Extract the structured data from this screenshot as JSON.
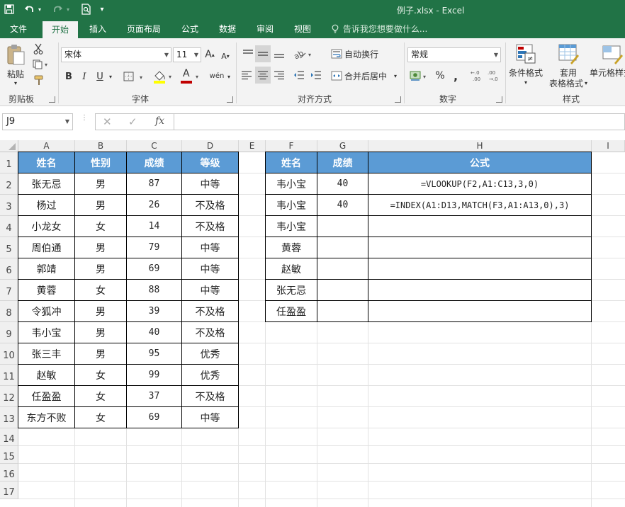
{
  "window": {
    "title": "例子.xlsx - Excel"
  },
  "colors": {
    "excel_green": "#217346",
    "header_blue": "#5b9bd5",
    "ribbon_bg": "#f3f3f3"
  },
  "quick_access": {
    "icons": [
      "save-icon",
      "undo-icon",
      "undo-dropdown-icon",
      "redo-icon",
      "redo-dropdown-icon",
      "print-preview-icon",
      "customize-qat-icon"
    ]
  },
  "tabs": [
    {
      "label": "文件"
    },
    {
      "label": "开始"
    },
    {
      "label": "插入"
    },
    {
      "label": "页面布局"
    },
    {
      "label": "公式"
    },
    {
      "label": "数据"
    },
    {
      "label": "审阅"
    },
    {
      "label": "视图"
    }
  ],
  "tell_me": "告诉我您想要做什么...",
  "ribbon": {
    "clipboard": {
      "label": "剪贴板",
      "paste": "粘贴"
    },
    "font": {
      "label": "字体",
      "name": "宋体",
      "size": "11",
      "bold": "B",
      "italic": "I",
      "underline": "U",
      "grow": "A",
      "shrink": "A",
      "color_letter": "A",
      "phonetic": "wén"
    },
    "alignment": {
      "label": "对齐方式",
      "wrap": "自动换行",
      "merge": "合并后居中"
    },
    "number": {
      "label": "数字",
      "format": "常规",
      "percent": "%",
      "comma": ",",
      "dec_inc": "←.0 .00",
      "dec_dec": ".00 →.0"
    },
    "styles": {
      "label": "样式",
      "cond_format": "条件格式",
      "table_format_1": "套用",
      "table_format_2": "表格格式",
      "cell_style": "单元格样式"
    }
  },
  "formula_bar": {
    "name_box": "J9",
    "cancel": "✕",
    "enter": "✓",
    "fx": "fx",
    "content": ""
  },
  "columns": [
    "A",
    "B",
    "C",
    "D",
    "E",
    "F",
    "G",
    "H",
    "I"
  ],
  "rows": [
    "1",
    "2",
    "3",
    "4",
    "5",
    "6",
    "7",
    "8",
    "9",
    "10",
    "11",
    "12",
    "13",
    "14",
    "15",
    "16",
    "17"
  ],
  "table1": {
    "headers": [
      "姓名",
      "性别",
      "成绩",
      "等级"
    ],
    "rows": [
      [
        "张无忌",
        "男",
        "87",
        "中等"
      ],
      [
        "杨过",
        "男",
        "26",
        "不及格"
      ],
      [
        "小龙女",
        "女",
        "14",
        "不及格"
      ],
      [
        "周伯通",
        "男",
        "79",
        "中等"
      ],
      [
        "郭靖",
        "男",
        "69",
        "中等"
      ],
      [
        "黄蓉",
        "女",
        "88",
        "中等"
      ],
      [
        "令狐冲",
        "男",
        "39",
        "不及格"
      ],
      [
        "韦小宝",
        "男",
        "40",
        "不及格"
      ],
      [
        "张三丰",
        "男",
        "95",
        "优秀"
      ],
      [
        "赵敏",
        "女",
        "99",
        "优秀"
      ],
      [
        "任盈盈",
        "女",
        "37",
        "不及格"
      ],
      [
        "东方不败",
        "女",
        "69",
        "中等"
      ]
    ]
  },
  "table2": {
    "headers": [
      "姓名",
      "成绩",
      "公式"
    ],
    "rows": [
      [
        "韦小宝",
        "40",
        "=VLOOKUP(F2,A1:C13,3,0)"
      ],
      [
        "韦小宝",
        "40",
        "=INDEX(A1:D13,MATCH(F3,A1:A13,0),3)"
      ],
      [
        "韦小宝",
        "",
        ""
      ],
      [
        "黄蓉",
        "",
        ""
      ],
      [
        "赵敏",
        "",
        ""
      ],
      [
        "张无忌",
        "",
        ""
      ],
      [
        "任盈盈",
        "",
        ""
      ]
    ]
  }
}
